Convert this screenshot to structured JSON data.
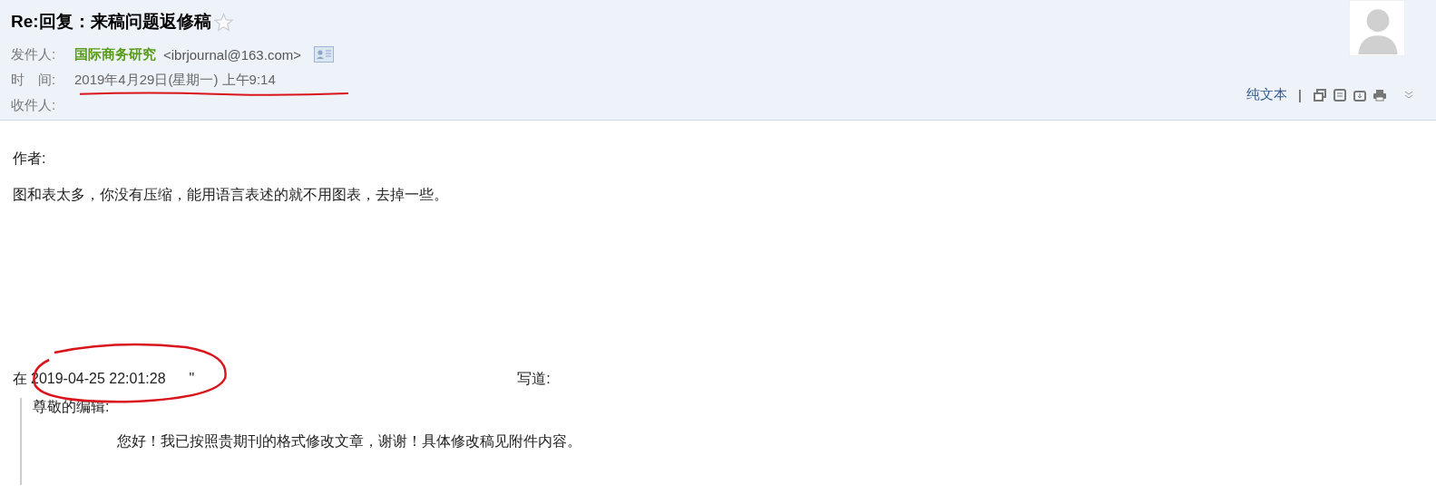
{
  "email": {
    "subject": "Re:回复：来稿问题返修稿",
    "starred": false,
    "sender": {
      "label": "发件人:",
      "name": "国际商务研究",
      "address": "<ibrjournal@163.com>"
    },
    "time": {
      "label": "时　间:",
      "value": "2019年4月29日(星期一) 上午9:14"
    },
    "recipient": {
      "label": "收件人:"
    },
    "toolbar": {
      "plain_text": "纯文本",
      "separator": "|"
    },
    "body": [
      "作者:",
      "图和表太多，你没有压缩，能用语言表述的就不用图表，去掉一些。"
    ],
    "quote": {
      "prefix": "在",
      "date": "2019-04-25 22:01:28",
      "quote_mark": "\"",
      "suffix": "写道:",
      "lines": [
        {
          "text": "尊敬的编辑:",
          "indented": false
        },
        {
          "text": "您好！我已按照贵期刊的格式修改文章，谢谢！具体修改稿见附件内容。",
          "indented": true
        }
      ]
    }
  }
}
